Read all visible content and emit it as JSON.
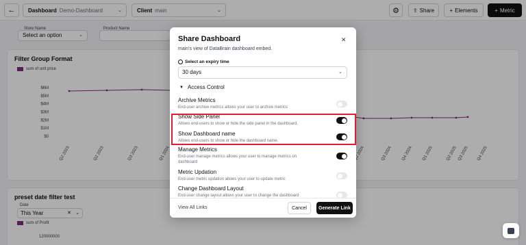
{
  "topbar": {
    "dashboard_label": "Dashboard",
    "dashboard_value": "Demo-Dashboard",
    "client_label": "Client",
    "client_value": "main",
    "share_label": "Share",
    "elements_label": "Elements",
    "metric_label": "Metric"
  },
  "filters": {
    "store_name_label": "Store Name",
    "store_name_value": "Select an option",
    "product_name_label": "Product Name"
  },
  "card1": {
    "title": "Filter Group Format",
    "legend": "sum of unit price"
  },
  "chart_data": {
    "type": "line",
    "title": "Filter Group Format",
    "series": [
      {
        "name": "sum of unit price",
        "color": "#7b2d7b"
      }
    ],
    "y_ticks": [
      "$6M",
      "$5M",
      "$4M",
      "$3M",
      "$2M",
      "$1M",
      "$0"
    ],
    "x_ticks_visible": [
      "Q2 2023",
      "Q2 2023",
      "Q3 2023",
      "Q1 2024",
      "Q2 2024",
      "Q3 2024",
      "Q4 2024",
      "Q1 2025",
      "Q2 2025",
      "Q3 2025",
      "Q4 2025"
    ],
    "ylim": [
      0,
      6000000
    ]
  },
  "card2": {
    "title": "preset date filter test",
    "date_label": "Date",
    "date_value": "This Year",
    "legend": "sum of Profit",
    "y_tick_top": "120000000"
  },
  "modal": {
    "title": "Share Dashboard",
    "description": "main's view of DataBrain dashboard embed.",
    "expiry_label": "Select an expiry time",
    "expiry_value": "30 days",
    "access_control_label": "Access Control",
    "settings": [
      {
        "title": "Archive Metrics",
        "desc": "End-user archive metrics allows your user to archive metrics",
        "enabled": false
      },
      {
        "title": "Show Side Panel",
        "desc": "Allows end-users to show or hide the side panel in the dashboard.",
        "enabled": true
      },
      {
        "title": "Show Dashboard name",
        "desc": "Allows end-users to show or hide the dashboard name.",
        "enabled": true
      },
      {
        "title": "Manage Metrics",
        "desc": "End-user manage metrics allows your user to manage metrics on dashboard",
        "enabled": true
      },
      {
        "title": "Metric Updation",
        "desc": "End-user metric updation allows your user to update metric",
        "enabled": false
      },
      {
        "title": "Change Dashboard Layout",
        "desc": "End-user change layout allows your user to change the dashboard",
        "enabled": false
      }
    ],
    "view_all_links": "View All Links",
    "cancel_label": "Cancel",
    "generate_label": "Generate Link"
  },
  "colors": {
    "accent": "#111111",
    "highlight": "#e11d2e",
    "series": "#7b2d7b"
  }
}
